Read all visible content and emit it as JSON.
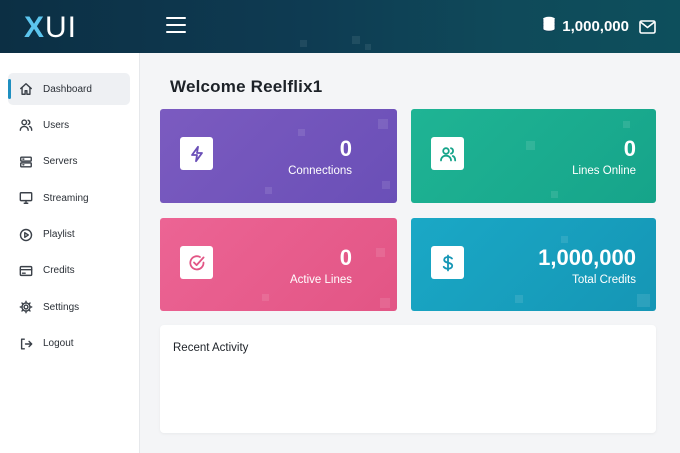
{
  "app": {
    "logo_x": "X",
    "logo_ui": "UI",
    "balance": "1,000,000",
    "icons": {
      "balance": "coin-stack-icon",
      "mail": "envelope-icon",
      "menu": "hamburger-icon"
    }
  },
  "sidebar": {
    "items": [
      {
        "label": "Dashboard",
        "icon": "home-icon",
        "active": true
      },
      {
        "label": "Users",
        "icon": "users-icon"
      },
      {
        "label": "Servers",
        "icon": "server-icon"
      },
      {
        "label": "Streaming",
        "icon": "monitor-icon"
      },
      {
        "label": "Playlist",
        "icon": "play-circle-icon"
      },
      {
        "label": "Credits",
        "icon": "credit-card-icon"
      },
      {
        "label": "Settings",
        "icon": "gear-icon"
      },
      {
        "label": "Logout",
        "icon": "logout-icon"
      }
    ]
  },
  "main": {
    "welcome": "Welcome Reelflix1",
    "cards": [
      {
        "value": "0",
        "label": "Connections",
        "icon": "lightning-icon",
        "color": "#6f53bb"
      },
      {
        "value": "0",
        "label": "Lines Online",
        "icon": "users-icon",
        "color": "#1aab8f"
      },
      {
        "value": "0",
        "label": "Active Lines",
        "icon": "check-circle-icon",
        "color": "#e85b8c"
      },
      {
        "value": "1,000,000",
        "label": "Total Credits",
        "icon": "dollar-icon",
        "color": "#189fbe"
      }
    ],
    "activity_title": "Recent Activity"
  },
  "colors": {
    "accent": "#1f8fc0",
    "topbar": "#0e3b52"
  }
}
